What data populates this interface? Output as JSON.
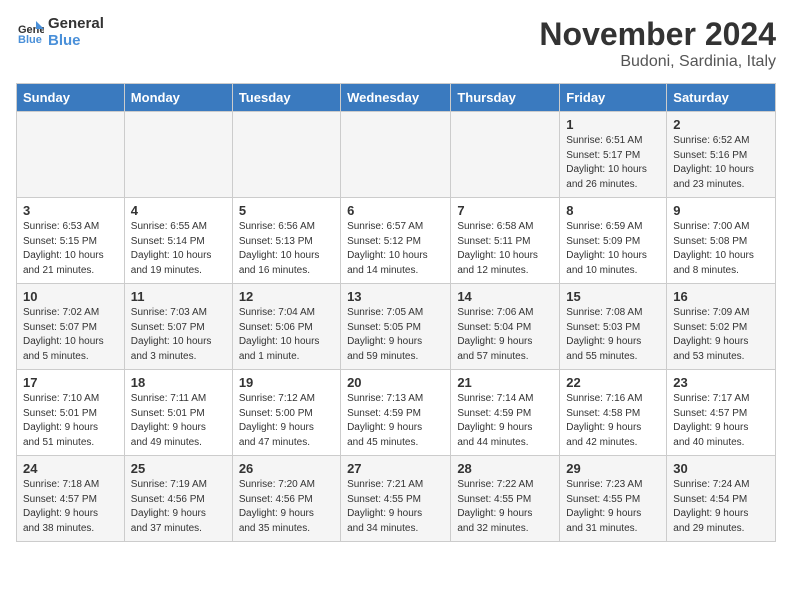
{
  "logo": {
    "line1": "General",
    "line2": "Blue"
  },
  "title": "November 2024",
  "location": "Budoni, Sardinia, Italy",
  "headers": [
    "Sunday",
    "Monday",
    "Tuesday",
    "Wednesday",
    "Thursday",
    "Friday",
    "Saturday"
  ],
  "weeks": [
    [
      {
        "day": "",
        "detail": ""
      },
      {
        "day": "",
        "detail": ""
      },
      {
        "day": "",
        "detail": ""
      },
      {
        "day": "",
        "detail": ""
      },
      {
        "day": "",
        "detail": ""
      },
      {
        "day": "1",
        "detail": "Sunrise: 6:51 AM\nSunset: 5:17 PM\nDaylight: 10 hours\nand 26 minutes."
      },
      {
        "day": "2",
        "detail": "Sunrise: 6:52 AM\nSunset: 5:16 PM\nDaylight: 10 hours\nand 23 minutes."
      }
    ],
    [
      {
        "day": "3",
        "detail": "Sunrise: 6:53 AM\nSunset: 5:15 PM\nDaylight: 10 hours\nand 21 minutes."
      },
      {
        "day": "4",
        "detail": "Sunrise: 6:55 AM\nSunset: 5:14 PM\nDaylight: 10 hours\nand 19 minutes."
      },
      {
        "day": "5",
        "detail": "Sunrise: 6:56 AM\nSunset: 5:13 PM\nDaylight: 10 hours\nand 16 minutes."
      },
      {
        "day": "6",
        "detail": "Sunrise: 6:57 AM\nSunset: 5:12 PM\nDaylight: 10 hours\nand 14 minutes."
      },
      {
        "day": "7",
        "detail": "Sunrise: 6:58 AM\nSunset: 5:11 PM\nDaylight: 10 hours\nand 12 minutes."
      },
      {
        "day": "8",
        "detail": "Sunrise: 6:59 AM\nSunset: 5:09 PM\nDaylight: 10 hours\nand 10 minutes."
      },
      {
        "day": "9",
        "detail": "Sunrise: 7:00 AM\nSunset: 5:08 PM\nDaylight: 10 hours\nand 8 minutes."
      }
    ],
    [
      {
        "day": "10",
        "detail": "Sunrise: 7:02 AM\nSunset: 5:07 PM\nDaylight: 10 hours\nand 5 minutes."
      },
      {
        "day": "11",
        "detail": "Sunrise: 7:03 AM\nSunset: 5:07 PM\nDaylight: 10 hours\nand 3 minutes."
      },
      {
        "day": "12",
        "detail": "Sunrise: 7:04 AM\nSunset: 5:06 PM\nDaylight: 10 hours\nand 1 minute."
      },
      {
        "day": "13",
        "detail": "Sunrise: 7:05 AM\nSunset: 5:05 PM\nDaylight: 9 hours\nand 59 minutes."
      },
      {
        "day": "14",
        "detail": "Sunrise: 7:06 AM\nSunset: 5:04 PM\nDaylight: 9 hours\nand 57 minutes."
      },
      {
        "day": "15",
        "detail": "Sunrise: 7:08 AM\nSunset: 5:03 PM\nDaylight: 9 hours\nand 55 minutes."
      },
      {
        "day": "16",
        "detail": "Sunrise: 7:09 AM\nSunset: 5:02 PM\nDaylight: 9 hours\nand 53 minutes."
      }
    ],
    [
      {
        "day": "17",
        "detail": "Sunrise: 7:10 AM\nSunset: 5:01 PM\nDaylight: 9 hours\nand 51 minutes."
      },
      {
        "day": "18",
        "detail": "Sunrise: 7:11 AM\nSunset: 5:01 PM\nDaylight: 9 hours\nand 49 minutes."
      },
      {
        "day": "19",
        "detail": "Sunrise: 7:12 AM\nSunset: 5:00 PM\nDaylight: 9 hours\nand 47 minutes."
      },
      {
        "day": "20",
        "detail": "Sunrise: 7:13 AM\nSunset: 4:59 PM\nDaylight: 9 hours\nand 45 minutes."
      },
      {
        "day": "21",
        "detail": "Sunrise: 7:14 AM\nSunset: 4:59 PM\nDaylight: 9 hours\nand 44 minutes."
      },
      {
        "day": "22",
        "detail": "Sunrise: 7:16 AM\nSunset: 4:58 PM\nDaylight: 9 hours\nand 42 minutes."
      },
      {
        "day": "23",
        "detail": "Sunrise: 7:17 AM\nSunset: 4:57 PM\nDaylight: 9 hours\nand 40 minutes."
      }
    ],
    [
      {
        "day": "24",
        "detail": "Sunrise: 7:18 AM\nSunset: 4:57 PM\nDaylight: 9 hours\nand 38 minutes."
      },
      {
        "day": "25",
        "detail": "Sunrise: 7:19 AM\nSunset: 4:56 PM\nDaylight: 9 hours\nand 37 minutes."
      },
      {
        "day": "26",
        "detail": "Sunrise: 7:20 AM\nSunset: 4:56 PM\nDaylight: 9 hours\nand 35 minutes."
      },
      {
        "day": "27",
        "detail": "Sunrise: 7:21 AM\nSunset: 4:55 PM\nDaylight: 9 hours\nand 34 minutes."
      },
      {
        "day": "28",
        "detail": "Sunrise: 7:22 AM\nSunset: 4:55 PM\nDaylight: 9 hours\nand 32 minutes."
      },
      {
        "day": "29",
        "detail": "Sunrise: 7:23 AM\nSunset: 4:55 PM\nDaylight: 9 hours\nand 31 minutes."
      },
      {
        "day": "30",
        "detail": "Sunrise: 7:24 AM\nSunset: 4:54 PM\nDaylight: 9 hours\nand 29 minutes."
      }
    ]
  ]
}
